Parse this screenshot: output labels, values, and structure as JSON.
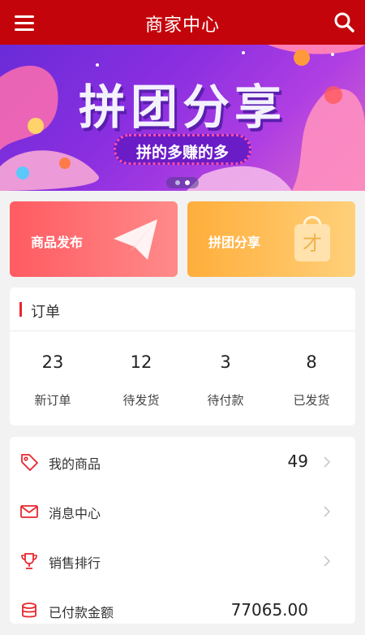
{
  "header": {
    "title": "商家中心"
  },
  "banner": {
    "title": "拼团分享",
    "subtitle": "拼的多赚的多"
  },
  "cards": [
    {
      "label": "商品发布"
    },
    {
      "label": "拼团分享"
    }
  ],
  "orders": {
    "title": "订单",
    "stats": [
      {
        "value": "23",
        "label": "新订单"
      },
      {
        "value": "12",
        "label": "待发货"
      },
      {
        "value": "3",
        "label": "待付款"
      },
      {
        "value": "8",
        "label": "已发货"
      }
    ]
  },
  "menu": [
    {
      "label": "我的商品",
      "value": "49",
      "icon": "tag-icon"
    },
    {
      "label": "消息中心",
      "value": "",
      "icon": "mail-icon"
    },
    {
      "label": "销售排行",
      "value": "",
      "icon": "trophy-icon"
    },
    {
      "label": "已付款金额",
      "value": "77065.00",
      "icon": "coins-icon"
    }
  ],
  "colors": {
    "brand": "#c4040b",
    "accent": "#e8262d"
  }
}
